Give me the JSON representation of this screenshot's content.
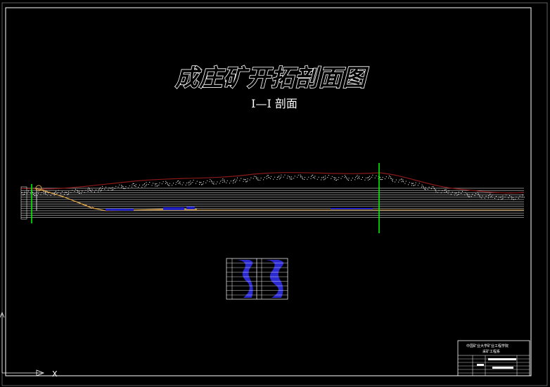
{
  "drawing": {
    "title": "成庄矿开拓剖面图",
    "section_label": "I—I 剖面"
  },
  "title_block": {
    "line1": "中国矿业大学矿业工程学院",
    "line2": "采矿工程系"
  },
  "colors": {
    "background": "#000000",
    "frame": "#ffffff",
    "surface_line": "#8b1a1a",
    "strata_lines": "#ffffff",
    "borehole": "#00ff00",
    "incline_shaft": "#d8a04a",
    "coal_seam": "#2020c0",
    "table_fill": "#2a2ad0"
  },
  "icons": {
    "ucs": "ucs-axis-icon",
    "borehole": "borehole-marker-icon"
  }
}
